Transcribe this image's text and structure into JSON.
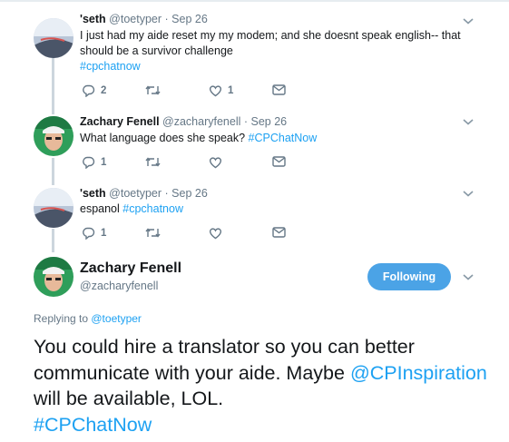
{
  "tweets": [
    {
      "name": "'seth",
      "handle": "@toetyper",
      "date": "Sep 26",
      "text": "I just had my aide  reset my  my  modem; and she doesnt speak  english-- that should be a survivor challenge",
      "hashtag": "#cpchatnow",
      "reply_count": "2",
      "retweet_count": "",
      "like_count": "1"
    },
    {
      "name": "Zachary Fenell",
      "handle": "@zacharyfenell",
      "date": "Sep 26",
      "text": "What language does she speak? ",
      "hashtag": "#CPChatNow",
      "reply_count": "1",
      "retweet_count": "",
      "like_count": ""
    },
    {
      "name": "'seth",
      "handle": "@toetyper",
      "date": "Sep 26",
      "text": "espanol ",
      "hashtag": "#cpchatnow",
      "reply_count": "1",
      "retweet_count": "",
      "like_count": ""
    }
  ],
  "main_tweet": {
    "name": "Zachary Fenell",
    "handle": "@zacharyfenell",
    "follow_label": "Following",
    "replying_prefix": "Replying to ",
    "replying_to": "@toetyper",
    "text_part1": "You could hire a translator so you can better communicate with your aide. Maybe ",
    "mention": "@CPInspiration",
    "text_part2": " will be available, LOL.",
    "hashtag": "#CPChatNow"
  },
  "icons": [
    "reply-icon",
    "retweet-icon",
    "like-icon",
    "direct-message-icon",
    "chevron-down-icon",
    "avatar"
  ],
  "colors": {
    "link": "#1da1f2",
    "follow_button": "#4ba3e6",
    "meta_text": "#657786",
    "thread_line": "#ccd6dd"
  }
}
